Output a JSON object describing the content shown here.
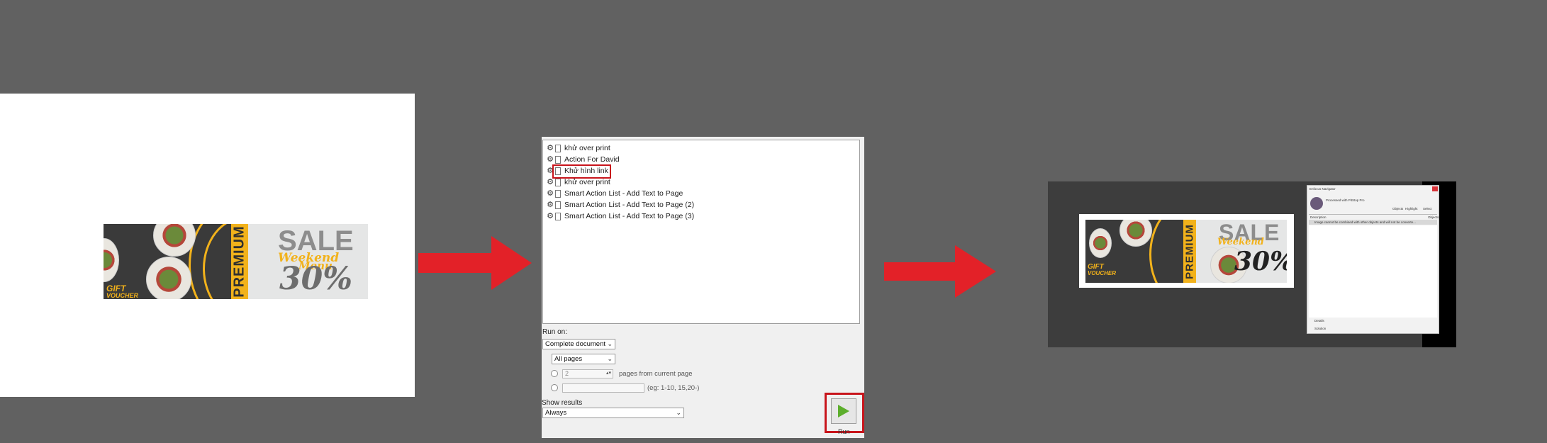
{
  "panel1": {
    "banner": {
      "gift_line1": "GIFT",
      "gift_line2": "VOUCHER",
      "premium": "PREMIUM",
      "sale": "SALE",
      "percent": "30%",
      "colors": {
        "dark": "#3a3a3a",
        "accent": "#f2b21b",
        "light": "#e5e6e6"
      }
    }
  },
  "arrows": {
    "color": "#e32128"
  },
  "panel2": {
    "action_list": [
      {
        "label": "khử over print"
      },
      {
        "label": "Action For David"
      },
      {
        "label": "Khử hình link",
        "highlighted": true
      },
      {
        "label": "khử over print"
      },
      {
        "label": "Smart Action List - Add Text to Page"
      },
      {
        "label": "Smart Action List - Add Text to Page (2)"
      },
      {
        "label": "Smart Action List - Add Text to Page (3)"
      }
    ],
    "run_on_label": "Run on:",
    "run_on_value": "Complete document",
    "pages_value": "All pages",
    "pages_count": "2",
    "pages_from_current": "pages from current page",
    "page_range_hint": "(eg: 1-10, 15,20-)",
    "show_results_label": "Show results",
    "show_results_value": "Always",
    "run_button_label": "Run",
    "highlight_color": "#c8141b"
  },
  "panel3": {
    "window_title": "Enfocus Navigator",
    "processed_text": "Processed with PitStop Pro",
    "objects_label": "Objects",
    "highlight_label": "Highlight",
    "select_label": "Select",
    "description_header": "Description",
    "objects_header": "Objects",
    "issue_text": "Image cannot be combined with other objects and will not be converte...",
    "details_label": "Details",
    "solution_label": "Solution",
    "sale": "SALE",
    "premium": "PREMIUM",
    "percent": "30%",
    "gift_line1": "GIFT",
    "gift_line2": "VOUCHER"
  }
}
